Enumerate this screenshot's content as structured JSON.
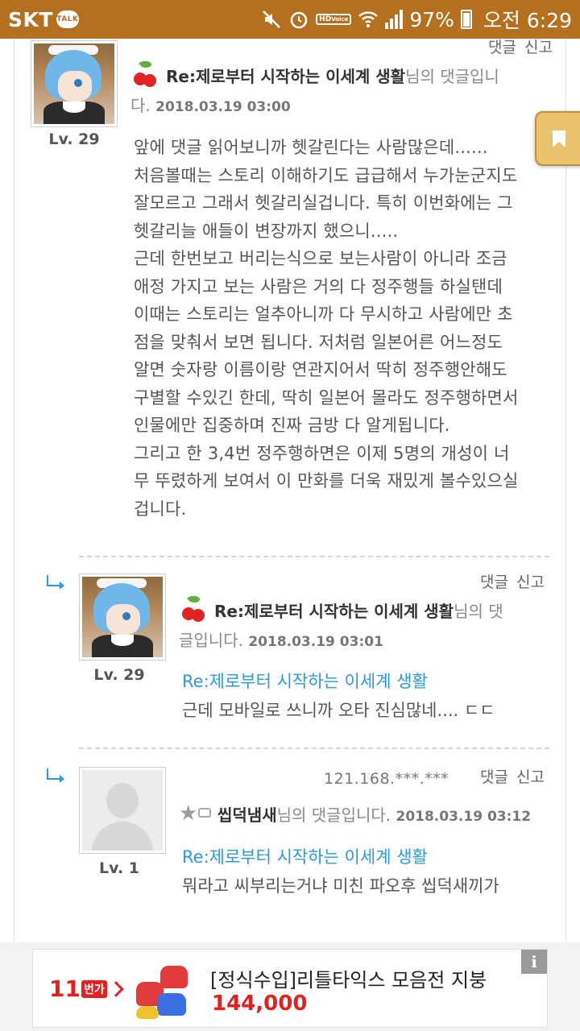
{
  "status_bar": {
    "carrier": "SKT",
    "talk_badge": "TALK",
    "hd_label": "HD",
    "voice_label": "Voice",
    "battery": "97%",
    "time": "오전 6:29"
  },
  "actions": {
    "reply": "댓글",
    "report": "신고"
  },
  "comments": [
    {
      "author": "Re:제로부터 시작하는 이세계 생활",
      "suffix_inline": "님의 댓글입니",
      "suffix_wrap": "다.",
      "date": "2018.03.19 03:00",
      "level": "Lv. 29",
      "body": [
        "앞에 댓글 읽어보니까 헷갈린다는 사람많은데......",
        "처음볼때는 스토리 이해하기도 급급해서 누가눈군지도",
        "잘모르고 그래서 헷갈리실겁니다. 특히 이번화에는 그",
        "헷갈리늘 애들이 변장까지 했으니.....",
        "근데 한번보고 버리는식으로 보는사람이 아니라 조금",
        "애정 가지고 보는 사람은 거의 다 정주행들 하실탠데",
        "이때는 스토리는 얼추아니까 다 무시하고 사람에만 초",
        "점을 맞춰서 보면 됩니다. 저처럼 일본어른 어느정도",
        "알면 숫자랑 이름이랑 연관지어서 딱히 정주행안해도",
        "구별할 수있긴 한데, 딱히 일본어 몰라도 정주행하면서",
        "인물에만 집중하며 진짜 금방 다 알게됩니다.",
        "그리고 한 3,4번 정주행하면은 이제 5명의 개성이 너",
        "무 뚜렸하게 보여서 이 만화를 더욱 재밌게 볼수있으실",
        "겁니다."
      ]
    },
    {
      "author": "Re:제로부터 시작하는 이세계 생활",
      "suffix_inline": "님의 댓",
      "suffix_wrap": "글입니다.",
      "date": "2018.03.19 03:01",
      "level": "Lv. 29",
      "quote": "Re:제로부터 시작하는 이세계 생활",
      "text": "근데 모바일로 쓰니까 오타 진심많네.... ㄷㄷ"
    },
    {
      "ip": "121.168.***.***",
      "author": "씹덕냄새",
      "suffix_inline": "님의 댓글입니다.",
      "date": "2018.03.19 03:12",
      "level": "Lv. 1",
      "quote": "Re:제로부터 시작하는 이세계 생활",
      "text": "뭐라고 씨부리는거냐 미친 파오후 씹덕새끼가"
    }
  ],
  "ad": {
    "logo": "11",
    "logo_sub": "번가",
    "title": "[정식수입]리틀타익스 모음전 지붕",
    "price": "144,000",
    "info": "i"
  },
  "colors": {
    "status_bar": "#b5701f",
    "link_blue": "#2b9ad8",
    "price_red": "#e5201f",
    "bookmark": "#e9c46d"
  }
}
